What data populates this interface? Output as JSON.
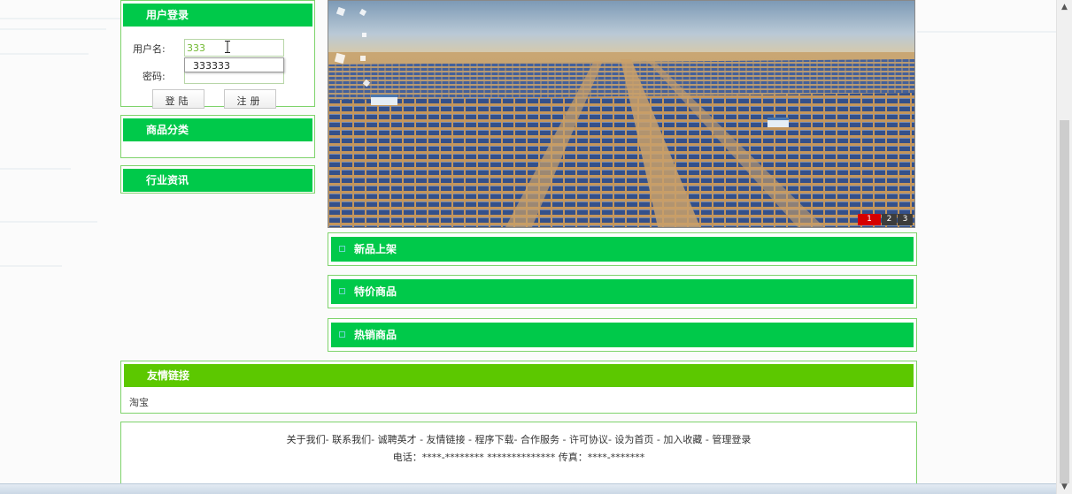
{
  "login": {
    "title": "用户登录",
    "username_label": "用户名:",
    "username_value": "333",
    "autocomplete_suggestion": "333333",
    "password_label": "密码:",
    "login_button": "登陆",
    "register_button": "注册"
  },
  "category": {
    "title": "商品分类"
  },
  "news": {
    "title": "行业资讯"
  },
  "banner": {
    "slides": [
      "1",
      "2",
      "3"
    ],
    "active_slide": "1"
  },
  "products": {
    "new": "新品上架",
    "special": "特价商品",
    "hot": "热销商品"
  },
  "links": {
    "title": "友情链接",
    "items": [
      "淘宝"
    ]
  },
  "footer": {
    "nav": "关于我们- 联系我们- 诚聘英才 - 友情链接 - 程序下载- 合作服务 - 许可协议- 设为首页 - 加入收藏 - 管理登录",
    "contact": "电话：****-******** ************** 传真：****-*******"
  },
  "colors": {
    "header_green": "#00c94a",
    "links_green": "#5cc800",
    "border_green": "#7ed36b",
    "active_slide_red": "#d60000"
  }
}
